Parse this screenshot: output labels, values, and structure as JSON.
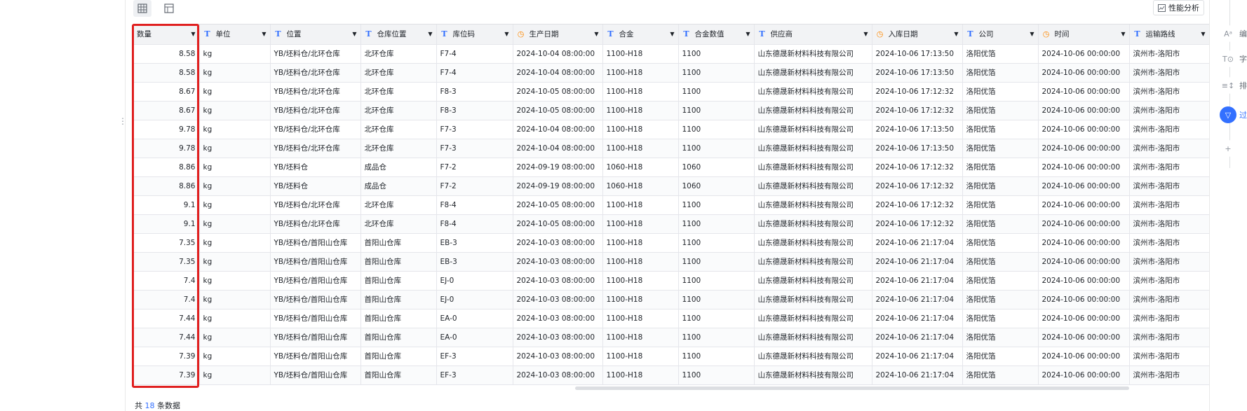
{
  "toolbar": {
    "grid_icon": "grid-icon",
    "layout_icon": "layout-icon",
    "perf_label": "性能分析"
  },
  "table": {
    "columns": [
      {
        "label": "数量",
        "type": "none",
        "width": 94,
        "align": "right"
      },
      {
        "label": "单位",
        "type": "text",
        "width": 101
      },
      {
        "label": "位置",
        "type": "text",
        "width": 129
      },
      {
        "label": "仓库位置",
        "type": "text",
        "width": 108
      },
      {
        "label": "库位码",
        "type": "text",
        "width": 109
      },
      {
        "label": "生产日期",
        "type": "date",
        "width": 128
      },
      {
        "label": "合金",
        "type": "text",
        "width": 108
      },
      {
        "label": "合金数值",
        "type": "text",
        "width": 108
      },
      {
        "label": "供应商",
        "type": "text",
        "width": 168
      },
      {
        "label": "入库日期",
        "type": "date",
        "width": 129
      },
      {
        "label": "公司",
        "type": "text",
        "width": 108
      },
      {
        "label": "时间",
        "type": "date",
        "width": 130
      },
      {
        "label": "运输路线",
        "type": "text",
        "width": 114
      }
    ],
    "rows": [
      [
        "8.58",
        "kg",
        "YB/坯料仓/北环仓库",
        "北环仓库",
        "F7-4",
        "2024-10-04 08:00:00",
        "1100-H18",
        "1100",
        "山东德晟新材料科技有限公司",
        "2024-10-06 17:13:50",
        "洛阳优箔",
        "2024-10-06 00:00:00",
        "滨州市-洛阳市"
      ],
      [
        "8.58",
        "kg",
        "YB/坯料仓/北环仓库",
        "北环仓库",
        "F7-4",
        "2024-10-04 08:00:00",
        "1100-H18",
        "1100",
        "山东德晟新材料科技有限公司",
        "2024-10-06 17:13:50",
        "洛阳优箔",
        "2024-10-06 00:00:00",
        "滨州市-洛阳市"
      ],
      [
        "8.67",
        "kg",
        "YB/坯料仓/北环仓库",
        "北环仓库",
        "F8-3",
        "2024-10-05 08:00:00",
        "1100-H18",
        "1100",
        "山东德晟新材料科技有限公司",
        "2024-10-06 17:12:32",
        "洛阳优箔",
        "2024-10-06 00:00:00",
        "滨州市-洛阳市"
      ],
      [
        "8.67",
        "kg",
        "YB/坯料仓/北环仓库",
        "北环仓库",
        "F8-3",
        "2024-10-05 08:00:00",
        "1100-H18",
        "1100",
        "山东德晟新材料科技有限公司",
        "2024-10-06 17:12:32",
        "洛阳优箔",
        "2024-10-06 00:00:00",
        "滨州市-洛阳市"
      ],
      [
        "9.78",
        "kg",
        "YB/坯料仓/北环仓库",
        "北环仓库",
        "F7-3",
        "2024-10-04 08:00:00",
        "1100-H18",
        "1100",
        "山东德晟新材料科技有限公司",
        "2024-10-06 17:13:50",
        "洛阳优箔",
        "2024-10-06 00:00:00",
        "滨州市-洛阳市"
      ],
      [
        "9.78",
        "kg",
        "YB/坯料仓/北环仓库",
        "北环仓库",
        "F7-3",
        "2024-10-04 08:00:00",
        "1100-H18",
        "1100",
        "山东德晟新材料科技有限公司",
        "2024-10-06 17:13:50",
        "洛阳优箔",
        "2024-10-06 00:00:00",
        "滨州市-洛阳市"
      ],
      [
        "8.86",
        "kg",
        "YB/坯料仓",
        "成品仓",
        "F7-2",
        "2024-09-19 08:00:00",
        "1060-H18",
        "1060",
        "山东德晟新材料科技有限公司",
        "2024-10-06 17:12:32",
        "洛阳优箔",
        "2024-10-06 00:00:00",
        "滨州市-洛阳市"
      ],
      [
        "8.86",
        "kg",
        "YB/坯料仓",
        "成品仓",
        "F7-2",
        "2024-09-19 08:00:00",
        "1060-H18",
        "1060",
        "山东德晟新材料科技有限公司",
        "2024-10-06 17:12:32",
        "洛阳优箔",
        "2024-10-06 00:00:00",
        "滨州市-洛阳市"
      ],
      [
        "9.1",
        "kg",
        "YB/坯料仓/北环仓库",
        "北环仓库",
        "F8-4",
        "2024-10-05 08:00:00",
        "1100-H18",
        "1100",
        "山东德晟新材料科技有限公司",
        "2024-10-06 17:12:32",
        "洛阳优箔",
        "2024-10-06 00:00:00",
        "滨州市-洛阳市"
      ],
      [
        "9.1",
        "kg",
        "YB/坯料仓/北环仓库",
        "北环仓库",
        "F8-4",
        "2024-10-05 08:00:00",
        "1100-H18",
        "1100",
        "山东德晟新材料科技有限公司",
        "2024-10-06 17:12:32",
        "洛阳优箔",
        "2024-10-06 00:00:00",
        "滨州市-洛阳市"
      ],
      [
        "7.35",
        "kg",
        "YB/坯料仓/首阳山仓库",
        "首阳山仓库",
        "EB-3",
        "2024-10-03 08:00:00",
        "1100-H18",
        "1100",
        "山东德晟新材料科技有限公司",
        "2024-10-06 21:17:04",
        "洛阳优箔",
        "2024-10-06 00:00:00",
        "滨州市-洛阳市"
      ],
      [
        "7.35",
        "kg",
        "YB/坯料仓/首阳山仓库",
        "首阳山仓库",
        "EB-3",
        "2024-10-03 08:00:00",
        "1100-H18",
        "1100",
        "山东德晟新材料科技有限公司",
        "2024-10-06 21:17:04",
        "洛阳优箔",
        "2024-10-06 00:00:00",
        "滨州市-洛阳市"
      ],
      [
        "7.4",
        "kg",
        "YB/坯料仓/首阳山仓库",
        "首阳山仓库",
        "EJ-0",
        "2024-10-03 08:00:00",
        "1100-H18",
        "1100",
        "山东德晟新材料科技有限公司",
        "2024-10-06 21:17:04",
        "洛阳优箔",
        "2024-10-06 00:00:00",
        "滨州市-洛阳市"
      ],
      [
        "7.4",
        "kg",
        "YB/坯料仓/首阳山仓库",
        "首阳山仓库",
        "EJ-0",
        "2024-10-03 08:00:00",
        "1100-H18",
        "1100",
        "山东德晟新材料科技有限公司",
        "2024-10-06 21:17:04",
        "洛阳优箔",
        "2024-10-06 00:00:00",
        "滨州市-洛阳市"
      ],
      [
        "7.44",
        "kg",
        "YB/坯料仓/首阳山仓库",
        "首阳山仓库",
        "EA-0",
        "2024-10-03 08:00:00",
        "1100-H18",
        "1100",
        "山东德晟新材料科技有限公司",
        "2024-10-06 21:17:04",
        "洛阳优箔",
        "2024-10-06 00:00:00",
        "滨州市-洛阳市"
      ],
      [
        "7.44",
        "kg",
        "YB/坯料仓/首阳山仓库",
        "首阳山仓库",
        "EA-0",
        "2024-10-03 08:00:00",
        "1100-H18",
        "1100",
        "山东德晟新材料科技有限公司",
        "2024-10-06 21:17:04",
        "洛阳优箔",
        "2024-10-06 00:00:00",
        "滨州市-洛阳市"
      ],
      [
        "7.39",
        "kg",
        "YB/坯料仓/首阳山仓库",
        "首阳山仓库",
        "EF-3",
        "2024-10-03 08:00:00",
        "1100-H18",
        "1100",
        "山东德晟新材料科技有限公司",
        "2024-10-06 21:17:04",
        "洛阳优箔",
        "2024-10-06 00:00:00",
        "滨州市-洛阳市"
      ],
      [
        "7.39",
        "kg",
        "YB/坯料仓/首阳山仓库",
        "首阳山仓库",
        "EF-3",
        "2024-10-03 08:00:00",
        "1100-H18",
        "1100",
        "山东德晟新材料科技有限公司",
        "2024-10-06 21:17:04",
        "洛阳优箔",
        "2024-10-06 00:00:00",
        "滨州市-洛阳市"
      ]
    ]
  },
  "footer": {
    "prefix": "共",
    "count": "18",
    "suffix": "条数据"
  },
  "right_panel": {
    "items": [
      {
        "icon": "text-style-icon",
        "glyph": "Aᵃ",
        "label": "编"
      },
      {
        "icon": "field-icon",
        "glyph": "T⊙",
        "label": "字"
      },
      {
        "icon": "sort-icon",
        "glyph": "≡↕",
        "label": "排"
      },
      {
        "icon": "filter-icon",
        "glyph": "▽",
        "label": "过",
        "active": true
      },
      {
        "icon": "add-icon",
        "glyph": "+",
        "label": ""
      }
    ]
  },
  "colors": {
    "accent": "#3370ff",
    "highlight": "#e02020",
    "date_icon": "#ff8800"
  }
}
